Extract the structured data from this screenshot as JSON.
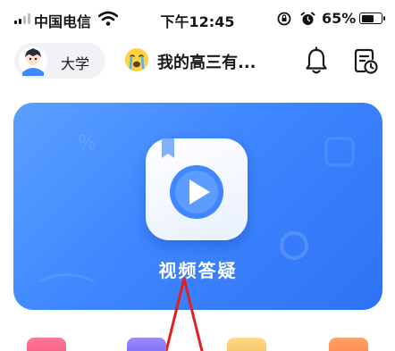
{
  "status_bar": {
    "carrier": "中国电信",
    "time": "下午12:45",
    "battery": "65%",
    "battery_level": 0.65
  },
  "top_bar": {
    "grade": "大学",
    "title": "我的高三有..."
  },
  "banner": {
    "label": "视频答疑"
  },
  "bottom_icons": [
    "book-icon",
    "search-icon",
    "folder-icon",
    "calendar-icon"
  ]
}
